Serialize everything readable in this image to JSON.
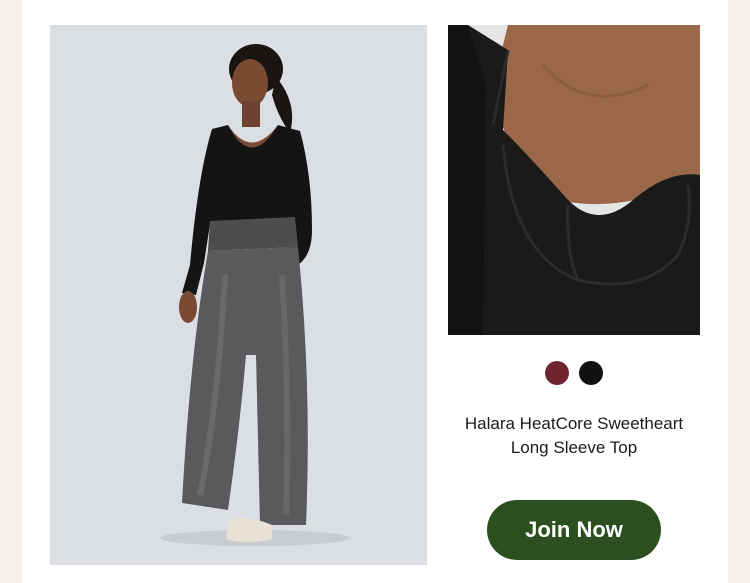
{
  "product": {
    "title_line1": "Halara HeatCore Sweetheart",
    "title_line2": "Long Sleeve Top",
    "swatches": [
      {
        "name": "burgundy",
        "color": "#6e2530"
      },
      {
        "name": "black",
        "color": "#111111"
      }
    ],
    "images": {
      "main": "full-body-model-photo",
      "detail": "neckline-closeup-photo"
    }
  },
  "cta": {
    "label": "Join Now",
    "color": "#2b4f1f"
  }
}
